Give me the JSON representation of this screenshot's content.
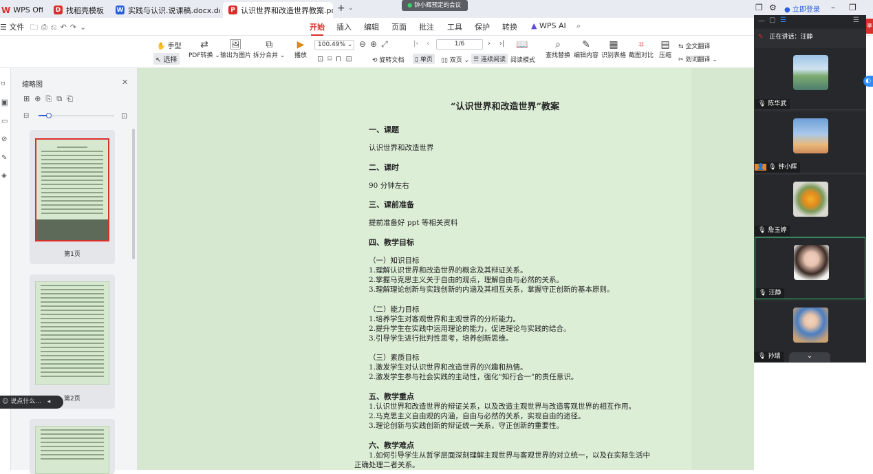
{
  "tabs": {
    "app_label": "WPS Office",
    "items": [
      {
        "label": "找稻壳模板"
      },
      {
        "label": "实践与认识.说课稿.docx.docx"
      },
      {
        "label": "认识世界和改造世界教案.pdf"
      }
    ],
    "add": "+"
  },
  "meeting_notice": "钟小辉预定的会议",
  "window": {
    "login": "立即登录"
  },
  "menu": {
    "file": "文件",
    "items": [
      "开始",
      "插入",
      "编辑",
      "页面",
      "批注",
      "工具",
      "保护",
      "转换",
      "WPS AI"
    ]
  },
  "toolbar": {
    "hand": "手型",
    "select": "选择",
    "pdf_convert": "PDF转换",
    "export_image": "输出为图片",
    "split_merge": "拆分合并",
    "play": "播放",
    "zoom": "100.49%",
    "page_box": "1/6",
    "rotate": "旋转文档",
    "single": "单页",
    "double": "双页",
    "continuous": "连续阅读",
    "read_mode": "阅读模式",
    "find_replace": "查找替换",
    "edit_content": "编辑内容",
    "recognize_table": "识别表格",
    "compare": "截图对比",
    "compress": "压缩",
    "full_translate": "全文翻译",
    "word_translate": "划词翻译"
  },
  "thumbnails": {
    "title": "缩略图",
    "pages": [
      {
        "label": "第1页"
      },
      {
        "label": "第2页"
      }
    ]
  },
  "chat_input": {
    "placeholder": "说点什么..."
  },
  "document": {
    "title": "“认识世界和改造世界”教案",
    "s1": "一、课题",
    "s1_text": "认识世界和改造世界",
    "s2": "二、课时",
    "s2_text": "90 分钟左右",
    "s3": "三、课前准备",
    "s3_text": "提前准备好 ppt 等相关资料",
    "s4": "四、教学目标",
    "g1": "（一）知识目标",
    "g1_1": "1.理解认识世界和改造世界的概念及其辩证关系。",
    "g1_2": "2.掌握马克思主义关于自由的观点，理解自由与必然的关系。",
    "g1_3": "3.理解理论创新与实践创新的内涵及其相互关系，掌握守正创新的基本原则。",
    "g2": "（二）能力目标",
    "g2_1": "1.培养学生对客观世界和主观世界的分析能力。",
    "g2_2": "2.提升学生在实践中运用理论的能力，促进理论与实践的结合。",
    "g2_3": "3.引导学生进行批判性思考，培养创新思维。",
    "g3": "（三）素质目标",
    "g3_1": "1.激发学生对认识世界和改造世界的兴趣和热情。",
    "g3_2": "2.激发学生参与社会实践的主动性，强化“知行合一”的责任意识。",
    "s5": "五、教学重点",
    "s5_1": "1.认识世界和改造世界的辩证关系，以及改造主观世界与改造客观世界的相互作用。",
    "s5_2": "2.马克思主义自由观的内涵，自由与必然的关系，实现自由的途径。",
    "s5_3": "3.理论创新与实践创新的辩证统一关系，守正创新的重要性。",
    "s6": "六、教学难点",
    "s6_1": "1.如何引导学生从哲学层面深刻理解主观世界与客观世界的对立统一，以及在实际生活中",
    "s6_1b": "正确处理二者关系。"
  },
  "meeting": {
    "speaking": "正在讲话：汪静",
    "participants": [
      {
        "name": "陈华武"
      },
      {
        "name": "钟小辉"
      },
      {
        "name": "詹玉婷"
      },
      {
        "name": "汪静"
      },
      {
        "name": "孙瑞"
      }
    ]
  },
  "colors": {
    "accent": "#d9302c",
    "page_bg": "#ddeed7",
    "speaking_border": "#2fb36b"
  }
}
